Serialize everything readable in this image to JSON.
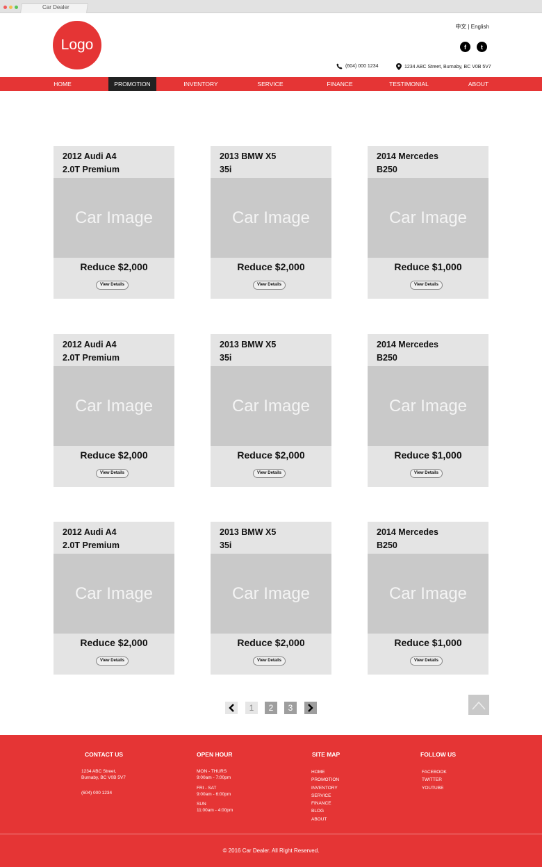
{
  "browser": {
    "tab_title": "Car Dealer"
  },
  "colors": {
    "brand_red": "#e53535",
    "nav_active": "#222222",
    "card_bg": "#e4e4e4",
    "image_placeholder": "#c9c9c9",
    "footer_red": "#e53535"
  },
  "header": {
    "logo_text": "Logo",
    "language": "中文 | English",
    "social": [
      {
        "icon": "facebook-icon",
        "glyph": "f"
      },
      {
        "icon": "twitter-icon",
        "glyph": "t"
      }
    ],
    "phone": "(604) 000 1234",
    "address": "1234 ABC Street, Burnaby, BC  V0B 5V7"
  },
  "nav": {
    "items": [
      {
        "label": "HOME"
      },
      {
        "label": "PROMOTION",
        "active": true
      },
      {
        "label": "INVENTORY"
      },
      {
        "label": "SERVICE"
      },
      {
        "label": "FINANCE"
      },
      {
        "label": "TESTIMONIAL"
      },
      {
        "label": "ABOUT"
      }
    ]
  },
  "cars": [
    {
      "title_line1": "2012 Audi A4",
      "title_line2": "2.0T Premium",
      "image": "Car Image",
      "price": "Reduce $2,000",
      "button": "View Details"
    },
    {
      "title_line1": "2013 BMW X5",
      "title_line2": "35i",
      "image": "Car Image",
      "price": "Reduce $2,000",
      "button": "View Details"
    },
    {
      "title_line1": "2014 Mercedes",
      "title_line2": "B250",
      "image": "Car Image",
      "price": "Reduce $1,000",
      "button": "View Details"
    },
    {
      "title_line1": "2012 Audi A4",
      "title_line2": "2.0T Premium",
      "image": "Car Image",
      "price": "Reduce $2,000",
      "button": "View Details"
    },
    {
      "title_line1": "2013 BMW X5",
      "title_line2": "35i",
      "image": "Car Image",
      "price": "Reduce $2,000",
      "button": "View Details"
    },
    {
      "title_line1": "2014 Mercedes",
      "title_line2": "B250",
      "image": "Car Image",
      "price": "Reduce $1,000",
      "button": "View Details"
    },
    {
      "title_line1": "2012 Audi A4",
      "title_line2": "2.0T Premium",
      "image": "Car Image",
      "price": "Reduce $2,000",
      "button": "View Details"
    },
    {
      "title_line1": "2013 BMW X5",
      "title_line2": "35i",
      "image": "Car Image",
      "price": "Reduce $2,000",
      "button": "View Details"
    },
    {
      "title_line1": "2014 Mercedes",
      "title_line2": "B250",
      "image": "Car Image",
      "price": "Reduce $1,000",
      "button": "View Details"
    }
  ],
  "pagination": {
    "prev_icon": "chevron-left-icon",
    "pages": [
      "1",
      "2",
      "3"
    ],
    "current_page": "1",
    "next_icon": "chevron-right-icon",
    "back_to_top_icon": "chevron-up-icon"
  },
  "footer": {
    "contact": {
      "heading": "CONTACT US",
      "address_line1": "1234 ABC Street,",
      "address_line2": "Burnaby, BC  V0B 5V7",
      "phone": "(604) 000 1234"
    },
    "hours": {
      "heading": "OPEN HOUR",
      "blocks": [
        {
          "days": "MON - THURS",
          "time": "9:00am - 7:00pm"
        },
        {
          "days": "FRI - SAT",
          "time": "9:00am - 6:00pm"
        },
        {
          "days": "SUN",
          "time": "11:00am - 4:00pm"
        }
      ]
    },
    "sitemap": {
      "heading": "SITE MAP",
      "links": [
        "HOME",
        "PROMOTION",
        "INVENTORY",
        "SERVICE",
        "FINANCE",
        "BLOG",
        "ABOUT"
      ]
    },
    "follow": {
      "heading": "FOLLOW US",
      "links": [
        "FACEBOOK",
        "TWITTER",
        "YOUTUBE"
      ]
    },
    "copyright": "© 2016 Car Dealer. All Right Reserved."
  }
}
